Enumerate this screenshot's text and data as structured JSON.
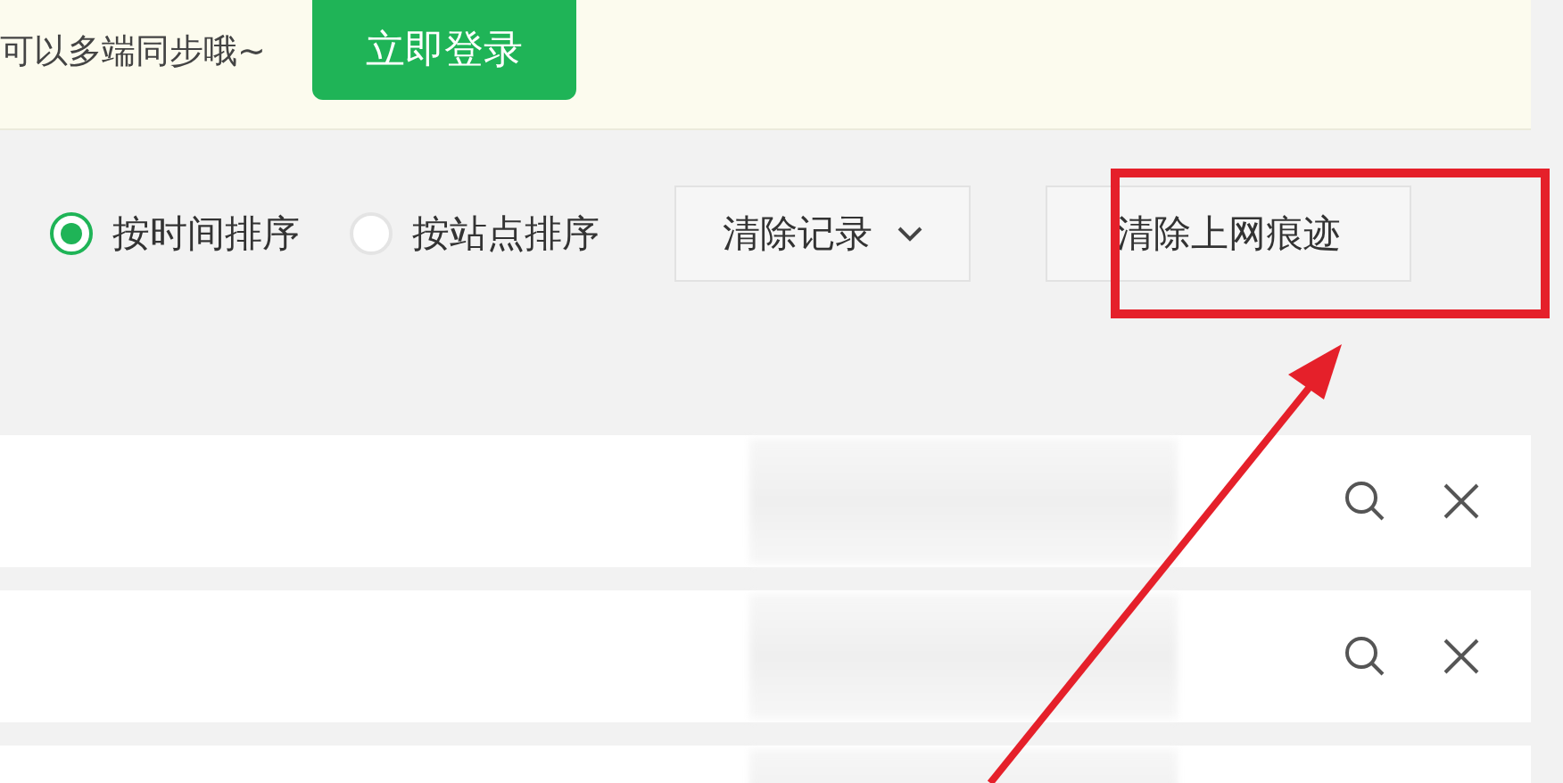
{
  "banner": {
    "message": "可以多端同步哦~",
    "login_button": "立即登录"
  },
  "sort_options": [
    {
      "label": "按时间排序",
      "selected": true
    },
    {
      "label": "按站点排序",
      "selected": false
    }
  ],
  "clear_records_button": "清除记录",
  "clear_traces_button": "清除上网痕迹",
  "history_rows": [
    {
      "kind": "entry"
    },
    {
      "kind": "entry"
    },
    {
      "kind": "entry-cut"
    }
  ],
  "annotation": {
    "kind": "box-arrow"
  }
}
